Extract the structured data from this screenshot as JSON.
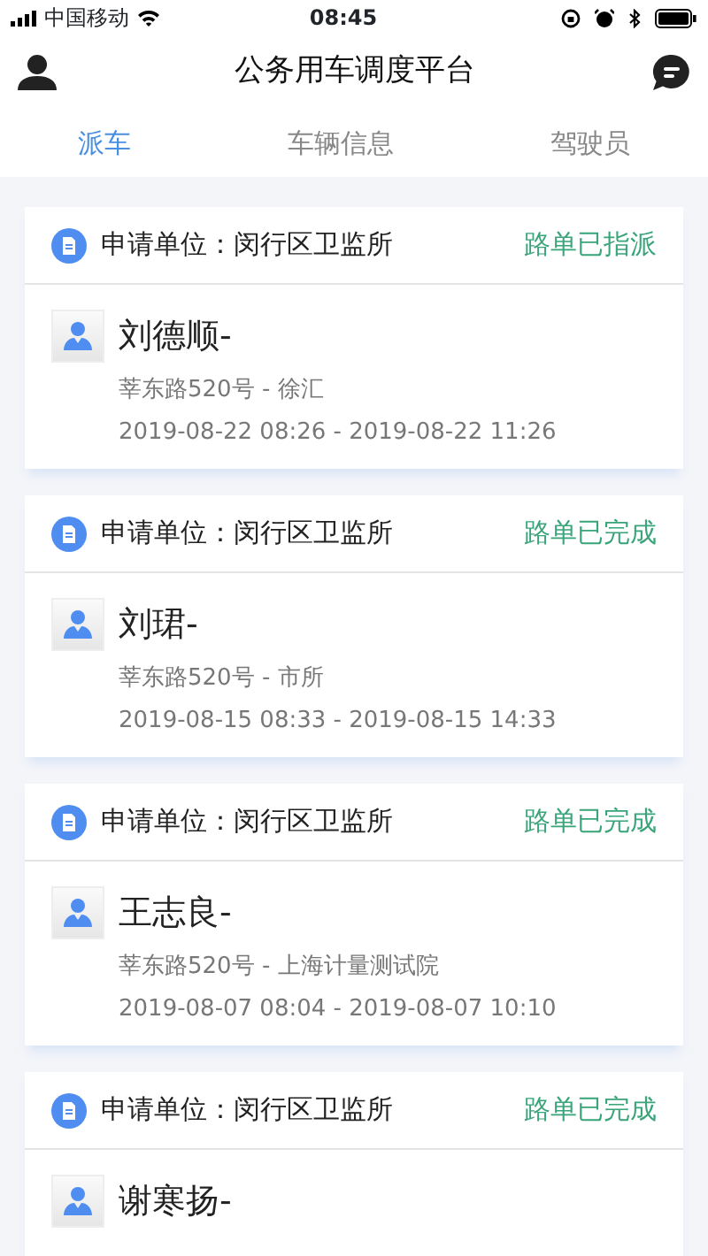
{
  "status_bar": {
    "carrier": "中国移动",
    "time": "08:45"
  },
  "header": {
    "title": "公务用车调度平台"
  },
  "tabs": [
    {
      "label": "派车",
      "selected": true
    },
    {
      "label": "车辆信息",
      "selected": false
    },
    {
      "label": "驾驶员",
      "selected": false
    }
  ],
  "orders": [
    {
      "unit": "申请单位：闵行区卫监所",
      "status": "路单已指派",
      "driver": "刘德顺-",
      "route": "莘东路520号 - 徐汇",
      "time": "2019-08-22 08:26 - 2019-08-22 11:26"
    },
    {
      "unit": "申请单位：闵行区卫监所",
      "status": "路单已完成",
      "driver": "刘珺-",
      "route": "莘东路520号 - 市所",
      "time": "2019-08-15 08:33 - 2019-08-15 14:33"
    },
    {
      "unit": "申请单位：闵行区卫监所",
      "status": "路单已完成",
      "driver": "王志良-",
      "route": "莘东路520号 - 上海计量测试院",
      "time": "2019-08-07 08:04 - 2019-08-07 10:10"
    },
    {
      "unit": "申请单位：闵行区卫监所",
      "status": "路单已完成",
      "driver": "谢寒扬-"
    }
  ]
}
